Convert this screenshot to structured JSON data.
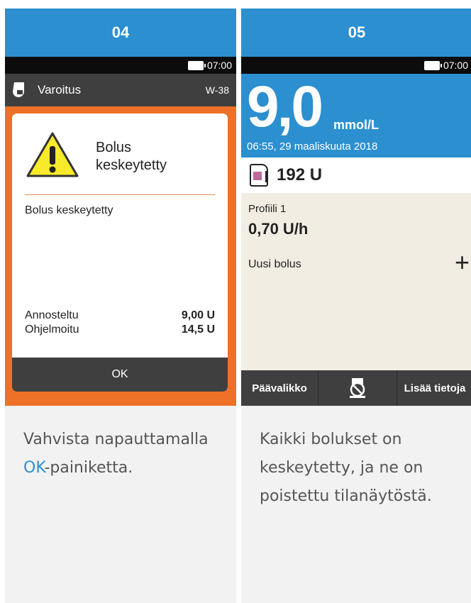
{
  "panels": [
    {
      "step": "04",
      "status_time": "07:00",
      "warning": {
        "title": "Varoitus",
        "code": "W-38"
      },
      "dialog": {
        "title_line1": "Bolus",
        "title_line2": "keskeytetty",
        "body": "Bolus keskeytetty",
        "rows": [
          {
            "label": "Annosteltu",
            "value": "9,00 U"
          },
          {
            "label": "Ohjelmoitu",
            "value": "14,5 U"
          }
        ],
        "ok_label": "OK"
      },
      "caption": {
        "line1": "Vahvista napauttamalla",
        "link": "OK",
        "rest": "-painiketta."
      }
    },
    {
      "step": "05",
      "status_time": "07:00",
      "glucose": {
        "value": "9,0",
        "unit": "mmol/L",
        "time": "06:55, 29 maaliskuuta 2018"
      },
      "reservoir": "192 U",
      "profile": {
        "label": "Profiili 1",
        "rate": "0,70 U/h"
      },
      "new_bolus": "Uusi bolus",
      "nav": {
        "left": "Päävalikko",
        "right": "Lisää tietoja"
      },
      "caption": {
        "line1": "Kaikki bolukset on",
        "line2": "keskeytetty, ja ne on",
        "line3": "poistettu tilanäytöstä."
      }
    }
  ],
  "colors": {
    "header_blue": "#2b8fd0",
    "alert_orange": "#ee7127",
    "dark_bar": "#3f3f3f"
  }
}
